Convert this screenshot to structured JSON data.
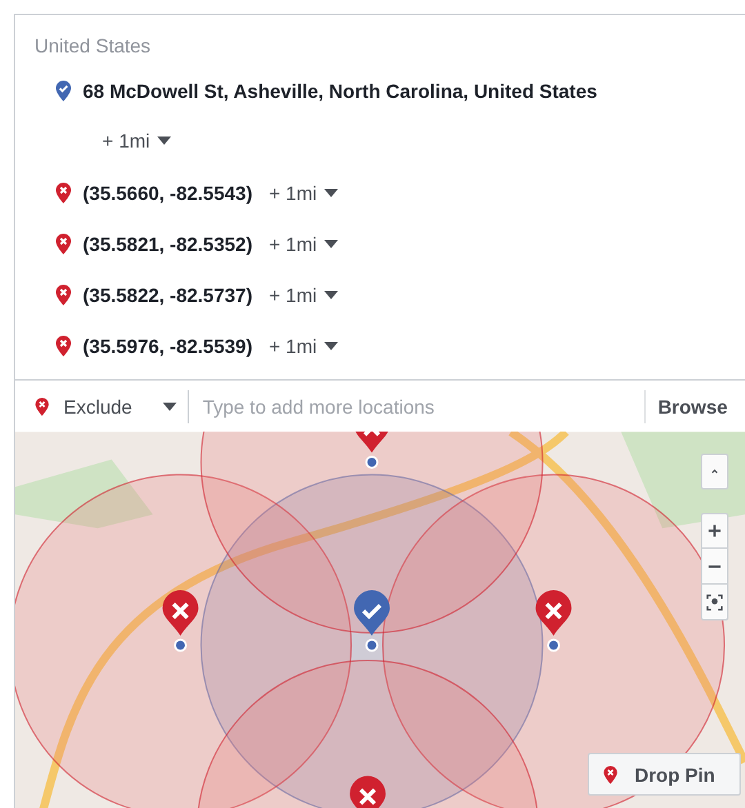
{
  "header": {
    "country": "United States"
  },
  "locations": [
    {
      "kind": "include",
      "label": "68 McDowell St, Asheville, North Carolina, United States",
      "radius": "+ 1mi"
    },
    {
      "kind": "exclude",
      "label": "(35.5660, -82.5543)",
      "radius": "+ 1mi"
    },
    {
      "kind": "exclude",
      "label": "(35.5821, -82.5352)",
      "radius": "+ 1mi"
    },
    {
      "kind": "exclude",
      "label": "(35.5822, -82.5737)",
      "radius": "+ 1mi"
    },
    {
      "kind": "exclude",
      "label": "(35.5976, -82.5539)",
      "radius": "+ 1mi"
    }
  ],
  "add_bar": {
    "mode": "Exclude",
    "placeholder": "Type to add more locations",
    "browse": "Browse"
  },
  "map": {
    "drop_pin": "Drop Pin"
  }
}
